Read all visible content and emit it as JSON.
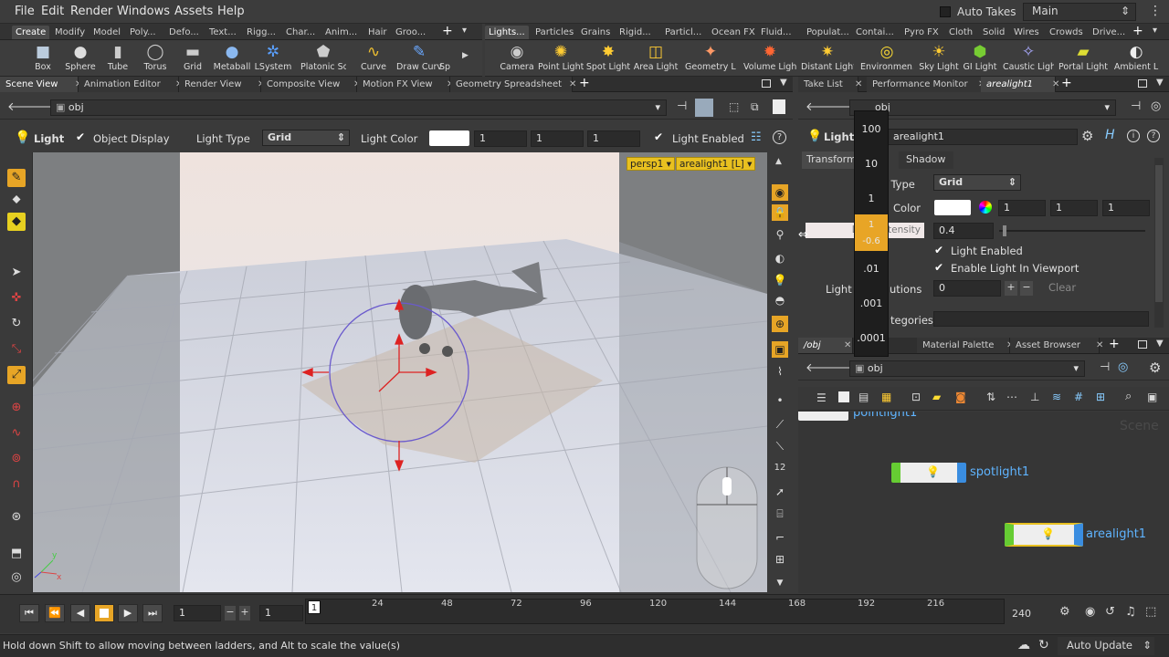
{
  "menu": [
    "File",
    "Edit",
    "Render",
    "Windows",
    "Assets",
    "Help"
  ],
  "autotakes": "Auto Takes",
  "desktop": "Main",
  "shelf_tabs_left": [
    "Create",
    "Modify",
    "Model",
    "Poly...",
    "Defo...",
    "Text...",
    "Rigg...",
    "Char...",
    "Anim...",
    "Hair",
    "Groo..."
  ],
  "shelf_tabs_right": [
    "Lights...",
    "Particles",
    "Grains",
    "Rigid...",
    "Particl...",
    "Ocean FX",
    "Fluid...",
    "Populat...",
    "Contai...",
    "Pyro FX",
    "Cloth",
    "Solid",
    "Wires",
    "Crowds",
    "Drive..."
  ],
  "tools_left": [
    {
      "label": "Box",
      "icon": "■"
    },
    {
      "label": "Sphere",
      "icon": "●"
    },
    {
      "label": "Tube",
      "icon": "▮"
    },
    {
      "label": "Torus",
      "icon": "◯"
    },
    {
      "label": "Grid",
      "icon": "▬"
    },
    {
      "label": "Metaball",
      "icon": "●"
    },
    {
      "label": "LSystem",
      "icon": "✲"
    },
    {
      "label": "Platonic Sol...",
      "icon": "⬟"
    },
    {
      "label": "Curve",
      "icon": "∿"
    },
    {
      "label": "Draw Curve",
      "icon": "✎"
    },
    {
      "label": "Sp",
      "icon": ""
    }
  ],
  "tools_right": [
    {
      "label": "Camera",
      "icon": "◉"
    },
    {
      "label": "Point Light",
      "icon": "✺"
    },
    {
      "label": "Spot Light",
      "icon": "✸"
    },
    {
      "label": "Area Light",
      "icon": "◫"
    },
    {
      "label": "Geometry L...",
      "icon": "✦"
    },
    {
      "label": "Volume Light",
      "icon": "✹"
    },
    {
      "label": "Distant Light",
      "icon": "✷"
    },
    {
      "label": "Environmen...",
      "icon": "◎"
    },
    {
      "label": "Sky Light",
      "icon": "☀"
    },
    {
      "label": "GI Light",
      "icon": "⬢"
    },
    {
      "label": "Caustic Light",
      "icon": "✧"
    },
    {
      "label": "Portal Light",
      "icon": "▰"
    },
    {
      "label": "Ambient L",
      "icon": "◐"
    }
  ],
  "left_tabs": [
    "Scene View",
    "Animation Editor",
    "Render View",
    "Composite View",
    "Motion FX View",
    "Geometry Spreadsheet"
  ],
  "left_path": "obj",
  "opbar": {
    "light": "Light",
    "object_display": "Object Display",
    "light_type_label": "Light Type",
    "light_type": "Grid",
    "light_color_label": "Light Color",
    "c1": "1",
    "c2": "1",
    "c3": "1",
    "light_enabled": "Light Enabled"
  },
  "viewport": {
    "camera": "persp1",
    "light": "arealight1 [L]"
  },
  "right_tabs": [
    "Take List",
    "Performance Monitor",
    "arealight1"
  ],
  "right_path": "obj",
  "param": {
    "light": "Light",
    "name": "arealight1",
    "tabs": [
      "Transform",
      "Shadow"
    ],
    "type_label": "ht Type",
    "type": "Grid",
    "color_label": "Color",
    "c1": "1",
    "c2": "1",
    "c3": "1",
    "intensity_label": "Light Intensity",
    "intensity": "0.4",
    "enabled": "Light Enabled",
    "viewport": "Enable Light In Viewport",
    "contrib_label": "Light",
    "contrib_label2": "utions",
    "contrib": "0",
    "clear": "Clear",
    "categories": "tegories"
  },
  "ladder": [
    "100",
    "10",
    "1",
    "1",
    "-0.6",
    ".01",
    ".001",
    ".0001"
  ],
  "net_tabs": [
    "/obj",
    "Material Palette",
    "Asset Browser"
  ],
  "net_path": "obj",
  "net_nodes": {
    "point": "pointlight1",
    "spot": "spotlight1",
    "area": "arealight1",
    "scene": "Scene"
  },
  "timeline": {
    "frame": "1",
    "start": "1",
    "end": "240",
    "cur": "1",
    "ticks": [
      "24",
      "48",
      "72",
      "96",
      "120",
      "144",
      "168",
      "192",
      "216"
    ]
  },
  "status": "Hold down Shift to allow moving between ladders, and Alt to scale the value(s)",
  "autoupdate": "Auto Update"
}
